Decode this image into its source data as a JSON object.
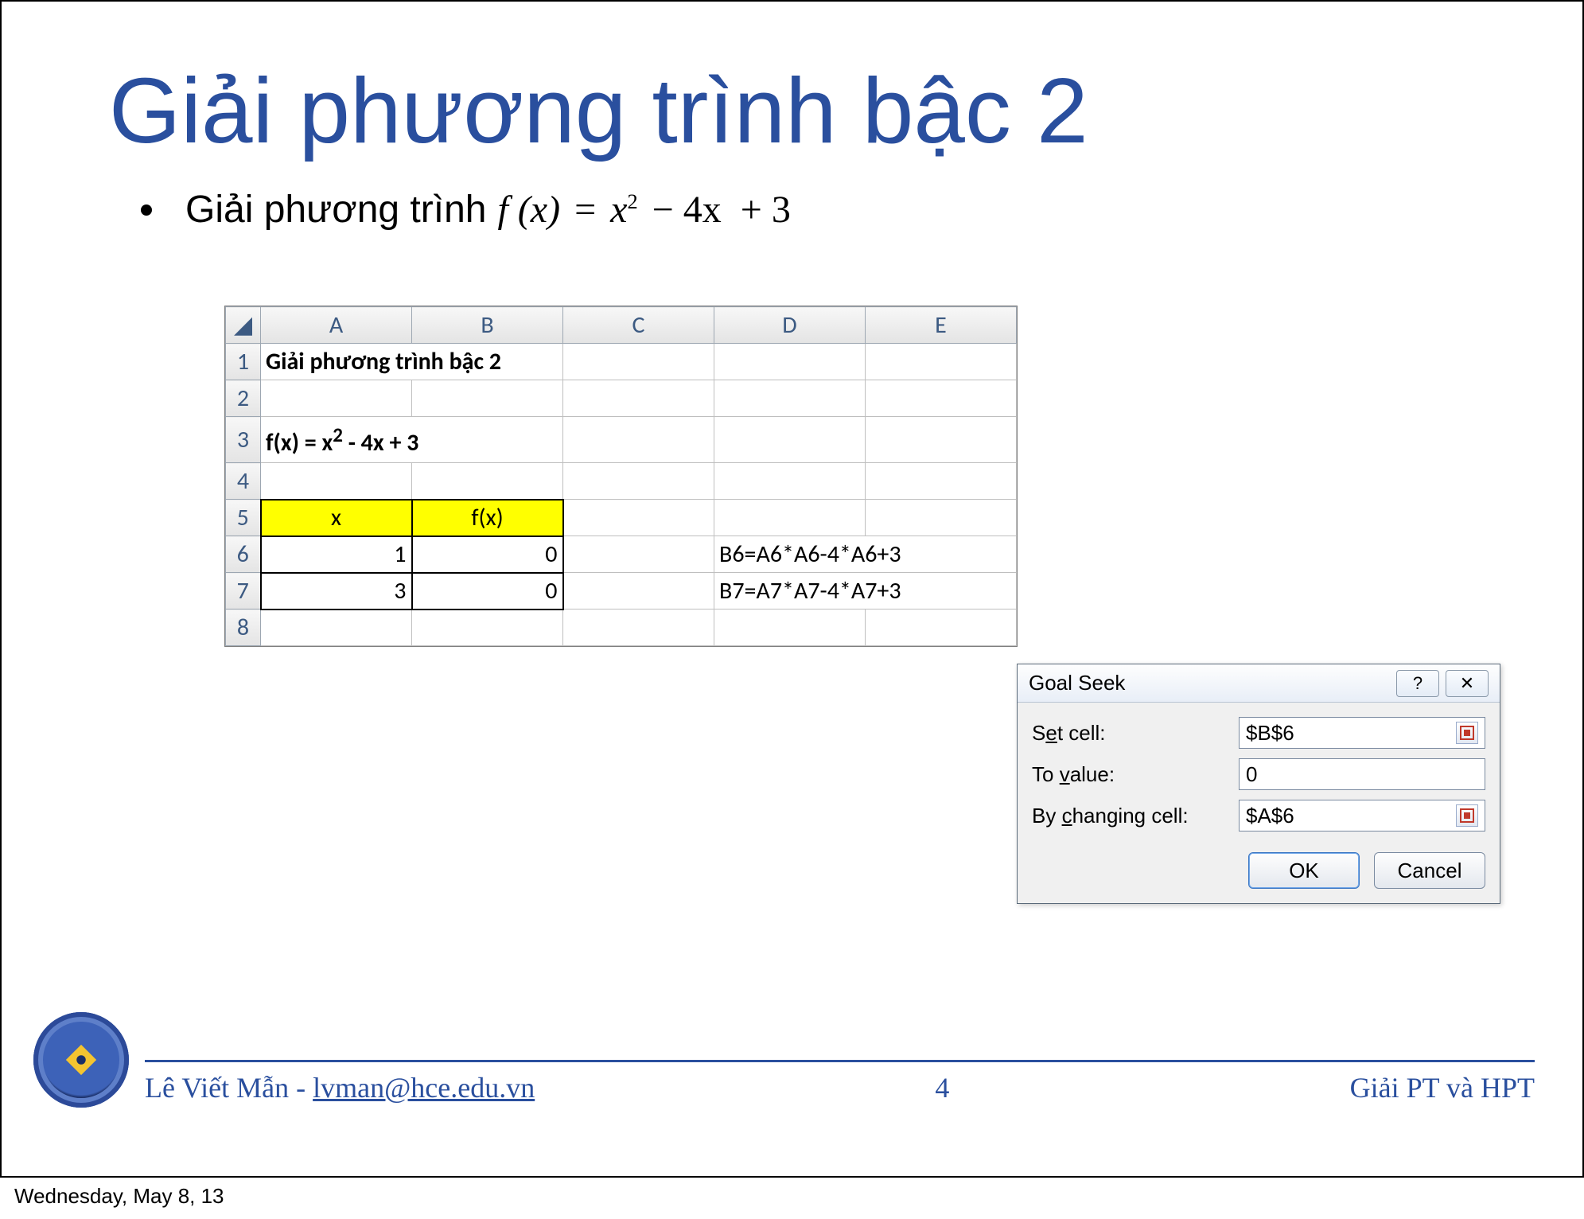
{
  "title": "Giải phương trình bậc 2",
  "bullet_text": "Giải phương trình",
  "equation": {
    "lhs": "f (x)",
    "rhs_terms": [
      "x",
      "2",
      "− 4x",
      "+ 3"
    ]
  },
  "spreadsheet": {
    "cols": [
      "A",
      "B",
      "C",
      "D",
      "E"
    ],
    "rows": [
      "1",
      "2",
      "3",
      "4",
      "5",
      "6",
      "7",
      "8"
    ],
    "r1A": "Giải phương trình bậc 2",
    "r3A_prefix": "f(x) = x",
    "r3A_sup": "2",
    "r3A_suffix": " - 4x + 3",
    "r5A": "x",
    "r5B": "f(x)",
    "r6A": "1",
    "r6B": "0",
    "r6D": "B6=A6*A6-4*A6+3",
    "r7A": "3",
    "r7B": "0",
    "r7D": "B7=A7*A7-4*A7+3"
  },
  "dialog": {
    "title": "Goal Seek",
    "help_glyph": "?",
    "close_glyph": "✕",
    "set_cell_label_pre": "S",
    "set_cell_label_u": "e",
    "set_cell_label_post": "t cell:",
    "set_cell_value": "$B$6",
    "to_value_label_pre": "To ",
    "to_value_label_u": "v",
    "to_value_label_post": "alue:",
    "to_value_value": "0",
    "by_label_pre": "By ",
    "by_label_u": "c",
    "by_label_post": "hanging cell:",
    "by_value": "$A$6",
    "ok": "OK",
    "cancel": "Cancel"
  },
  "footer": {
    "author": "Lê Viết Mẫn - ",
    "email": "lvman@hce.edu.vn",
    "page": "4",
    "module": "Giải PT và HPT"
  },
  "date": "Wednesday, May 8, 13"
}
